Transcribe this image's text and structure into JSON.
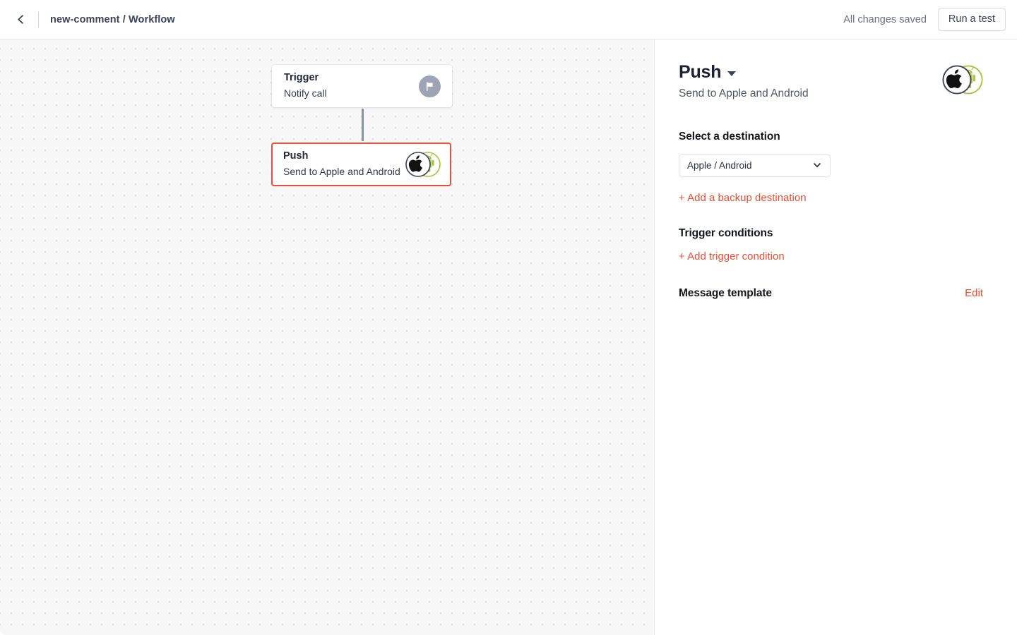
{
  "topbar": {
    "back_icon": "chevron-left-icon",
    "breadcrumb": "new-comment / Workflow",
    "save_status": "All changes saved",
    "run_test_label": "Run a test"
  },
  "canvas": {
    "nodes": [
      {
        "title": "Trigger",
        "subtitle": "Notify call",
        "icon": "flag-icon",
        "selected": false
      },
      {
        "title": "Push",
        "subtitle": "Send to Apple and Android",
        "icon": "apple-android-icon",
        "selected": true
      }
    ],
    "connector": "vertical-connector-line"
  },
  "panel": {
    "title": "Push",
    "title_caret_icon": "caret-down-icon",
    "subtitle": "Send to Apple and Android",
    "header_icon": "apple-android-icon",
    "destination": {
      "label": "Select a destination",
      "selected": "Apple / Android",
      "chevron_icon": "chevron-down-icon",
      "add_backup_label": "+ Add a backup destination"
    },
    "trigger_conditions": {
      "label": "Trigger conditions",
      "add_label": "+ Add trigger condition"
    },
    "message_template": {
      "label": "Message template",
      "edit_label": "Edit"
    }
  },
  "colors": {
    "accent": "#f04b32",
    "selected_border": "#e8503a",
    "android_green": "#a4c639",
    "text_dark": "#1b2033",
    "canvas_bg": "#f7f7f8"
  }
}
